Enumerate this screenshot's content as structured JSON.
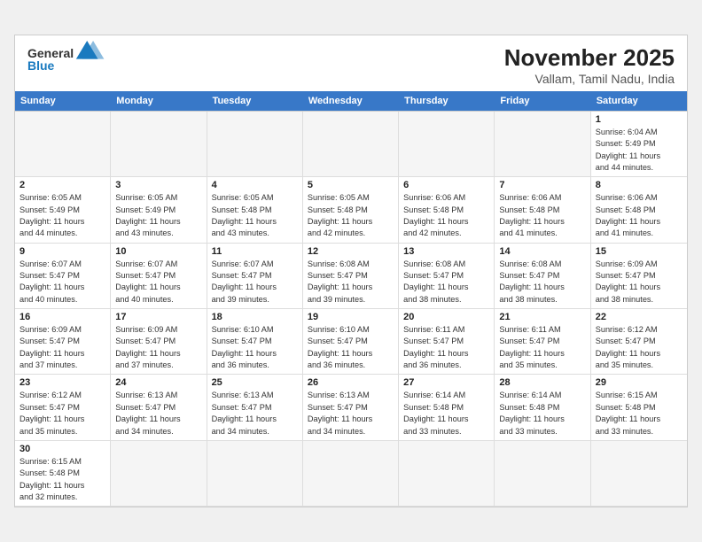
{
  "header": {
    "logo_general": "General",
    "logo_blue": "Blue",
    "title": "November 2025",
    "subtitle": "Vallam, Tamil Nadu, India"
  },
  "days": [
    "Sunday",
    "Monday",
    "Tuesday",
    "Wednesday",
    "Thursday",
    "Friday",
    "Saturday"
  ],
  "weeks": [
    [
      {
        "day": "",
        "info": ""
      },
      {
        "day": "",
        "info": ""
      },
      {
        "day": "",
        "info": ""
      },
      {
        "day": "",
        "info": ""
      },
      {
        "day": "",
        "info": ""
      },
      {
        "day": "",
        "info": ""
      },
      {
        "day": "1",
        "info": "Sunrise: 6:04 AM\nSunset: 5:49 PM\nDaylight: 11 hours\nand 44 minutes."
      }
    ],
    [
      {
        "day": "2",
        "info": "Sunrise: 6:05 AM\nSunset: 5:49 PM\nDaylight: 11 hours\nand 44 minutes."
      },
      {
        "day": "3",
        "info": "Sunrise: 6:05 AM\nSunset: 5:49 PM\nDaylight: 11 hours\nand 43 minutes."
      },
      {
        "day": "4",
        "info": "Sunrise: 6:05 AM\nSunset: 5:48 PM\nDaylight: 11 hours\nand 43 minutes."
      },
      {
        "day": "5",
        "info": "Sunrise: 6:05 AM\nSunset: 5:48 PM\nDaylight: 11 hours\nand 42 minutes."
      },
      {
        "day": "6",
        "info": "Sunrise: 6:06 AM\nSunset: 5:48 PM\nDaylight: 11 hours\nand 42 minutes."
      },
      {
        "day": "7",
        "info": "Sunrise: 6:06 AM\nSunset: 5:48 PM\nDaylight: 11 hours\nand 41 minutes."
      },
      {
        "day": "8",
        "info": "Sunrise: 6:06 AM\nSunset: 5:48 PM\nDaylight: 11 hours\nand 41 minutes."
      }
    ],
    [
      {
        "day": "9",
        "info": "Sunrise: 6:07 AM\nSunset: 5:47 PM\nDaylight: 11 hours\nand 40 minutes."
      },
      {
        "day": "10",
        "info": "Sunrise: 6:07 AM\nSunset: 5:47 PM\nDaylight: 11 hours\nand 40 minutes."
      },
      {
        "day": "11",
        "info": "Sunrise: 6:07 AM\nSunset: 5:47 PM\nDaylight: 11 hours\nand 39 minutes."
      },
      {
        "day": "12",
        "info": "Sunrise: 6:08 AM\nSunset: 5:47 PM\nDaylight: 11 hours\nand 39 minutes."
      },
      {
        "day": "13",
        "info": "Sunrise: 6:08 AM\nSunset: 5:47 PM\nDaylight: 11 hours\nand 38 minutes."
      },
      {
        "day": "14",
        "info": "Sunrise: 6:08 AM\nSunset: 5:47 PM\nDaylight: 11 hours\nand 38 minutes."
      },
      {
        "day": "15",
        "info": "Sunrise: 6:09 AM\nSunset: 5:47 PM\nDaylight: 11 hours\nand 38 minutes."
      }
    ],
    [
      {
        "day": "16",
        "info": "Sunrise: 6:09 AM\nSunset: 5:47 PM\nDaylight: 11 hours\nand 37 minutes."
      },
      {
        "day": "17",
        "info": "Sunrise: 6:09 AM\nSunset: 5:47 PM\nDaylight: 11 hours\nand 37 minutes."
      },
      {
        "day": "18",
        "info": "Sunrise: 6:10 AM\nSunset: 5:47 PM\nDaylight: 11 hours\nand 36 minutes."
      },
      {
        "day": "19",
        "info": "Sunrise: 6:10 AM\nSunset: 5:47 PM\nDaylight: 11 hours\nand 36 minutes."
      },
      {
        "day": "20",
        "info": "Sunrise: 6:11 AM\nSunset: 5:47 PM\nDaylight: 11 hours\nand 36 minutes."
      },
      {
        "day": "21",
        "info": "Sunrise: 6:11 AM\nSunset: 5:47 PM\nDaylight: 11 hours\nand 35 minutes."
      },
      {
        "day": "22",
        "info": "Sunrise: 6:12 AM\nSunset: 5:47 PM\nDaylight: 11 hours\nand 35 minutes."
      }
    ],
    [
      {
        "day": "23",
        "info": "Sunrise: 6:12 AM\nSunset: 5:47 PM\nDaylight: 11 hours\nand 35 minutes."
      },
      {
        "day": "24",
        "info": "Sunrise: 6:13 AM\nSunset: 5:47 PM\nDaylight: 11 hours\nand 34 minutes."
      },
      {
        "day": "25",
        "info": "Sunrise: 6:13 AM\nSunset: 5:47 PM\nDaylight: 11 hours\nand 34 minutes."
      },
      {
        "day": "26",
        "info": "Sunrise: 6:13 AM\nSunset: 5:47 PM\nDaylight: 11 hours\nand 34 minutes."
      },
      {
        "day": "27",
        "info": "Sunrise: 6:14 AM\nSunset: 5:48 PM\nDaylight: 11 hours\nand 33 minutes."
      },
      {
        "day": "28",
        "info": "Sunrise: 6:14 AM\nSunset: 5:48 PM\nDaylight: 11 hours\nand 33 minutes."
      },
      {
        "day": "29",
        "info": "Sunrise: 6:15 AM\nSunset: 5:48 PM\nDaylight: 11 hours\nand 33 minutes."
      }
    ],
    [
      {
        "day": "30",
        "info": "Sunrise: 6:15 AM\nSunset: 5:48 PM\nDaylight: 11 hours\nand 32 minutes."
      },
      {
        "day": "",
        "info": ""
      },
      {
        "day": "",
        "info": ""
      },
      {
        "day": "",
        "info": ""
      },
      {
        "day": "",
        "info": ""
      },
      {
        "day": "",
        "info": ""
      },
      {
        "day": "",
        "info": ""
      }
    ]
  ]
}
